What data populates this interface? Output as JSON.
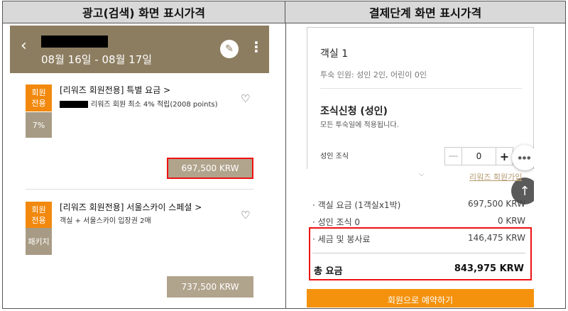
{
  "headers": {
    "left": "광고(검색) 화면 표시가격",
    "right": "결제단계 화면 표시가격"
  },
  "search": {
    "back_icon": "‹",
    "dates": "08월 16일 - 08월 17일",
    "edit_icon": "✎",
    "more_icon": "⋮",
    "listings": [
      {
        "badge": "회원\n전용",
        "discount": "7%",
        "title": "[리워즈 회원전용] 특별 요금 >",
        "subtitle": "리워즈 회원 최소 4% 적립(2008 points)",
        "price": "697,500 KRW"
      },
      {
        "badge": "회원\n전용",
        "tag": "패키지",
        "title": "[리워즈 회원전용] 서울스카이 스페셜 >",
        "subtitle": "객실 + 서울스카이 입장권 2매",
        "price": "737,500 KRW"
      }
    ],
    "heart_icon": "♡"
  },
  "checkout": {
    "room_title": "객실 1",
    "guests": "투숙 인원: 성인 2인, 어린이 0인",
    "breakfast_title": "조식신청 (성인)",
    "breakfast_sub": "모든 투숙일에 적용됩니다.",
    "adult_breakfast_label": "성인 조식",
    "quantity": "0",
    "minus_label": "—",
    "plus_label": "+",
    "chat_icon": "●●●",
    "up_icon": "↑",
    "expand_icon": "⌵",
    "signup_link": "리워즈 회원가입",
    "rows": [
      {
        "label": "객실 요금 (1객실x1박)",
        "value": "697,500 KRW"
      },
      {
        "label": "성인 조식 0",
        "value": "0 KRW"
      },
      {
        "label": "세금 및 봉사료",
        "value": "146,475 KRW"
      }
    ],
    "total_label": "총 요금",
    "total_value": "843,975 KRW",
    "cta_label": "회원으로 예약하기"
  },
  "colors": {
    "brand": "#8d7d60",
    "accent": "#f2890e",
    "highlight": "#e11111"
  }
}
